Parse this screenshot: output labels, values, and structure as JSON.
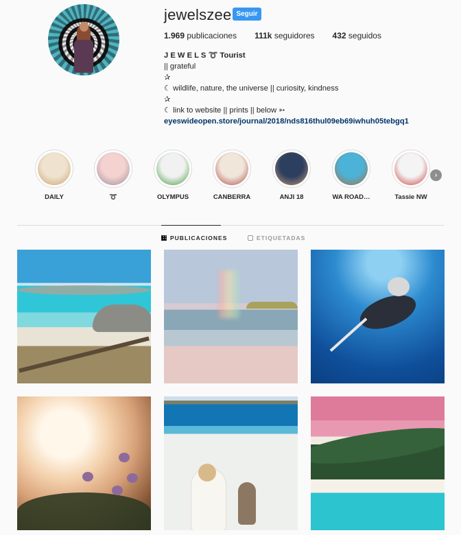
{
  "profile": {
    "username": "jewelszee",
    "follow_label": "Seguir",
    "stats": [
      {
        "count": "1.969",
        "label": "publicaciones"
      },
      {
        "count": "111k",
        "label": "seguidores"
      },
      {
        "count": "432",
        "label": "seguidos"
      }
    ],
    "bio": {
      "name": "J E W E L S ➰ Tourist",
      "lines": [
        "|| grateful",
        "✰",
        "☾ wildlife, nature, the universe || curiosity, kindness",
        "✰",
        "☾ link to website || prints || below ➳"
      ],
      "link": "eyeswideopen.store/journal/2018/nds816thul09eb69iwhuh05tebgq1"
    }
  },
  "highlights": [
    {
      "label": "DAILY",
      "color1": "#efe3d0",
      "color2": "#c9a06a"
    },
    {
      "label": "➰",
      "color1": "#f3d2cf",
      "color2": "#9a8a9b"
    },
    {
      "label": "OLYMPUS",
      "color1": "#f1f1f1",
      "color2": "#3f9a3a"
    },
    {
      "label": "CANBERRA",
      "color1": "#f0e6da",
      "color2": "#b04848"
    },
    {
      "label": "ANJI 18",
      "color1": "#2d3f5e",
      "color2": "#c79a7a"
    },
    {
      "label": "WA ROAD…",
      "color1": "#4cb2d8",
      "color2": "#a9703e"
    },
    {
      "label": "Tassie NW",
      "color1": "#f4f4f4",
      "color2": "#c73a3a"
    }
  ],
  "tabs": {
    "posts": "PUBLICACIONES",
    "tagged": "ETIQUETADAS"
  },
  "icons": {
    "next": "chevron-right-icon",
    "posts_tab": "grid-icon",
    "tagged_tab": "tag-icon"
  }
}
